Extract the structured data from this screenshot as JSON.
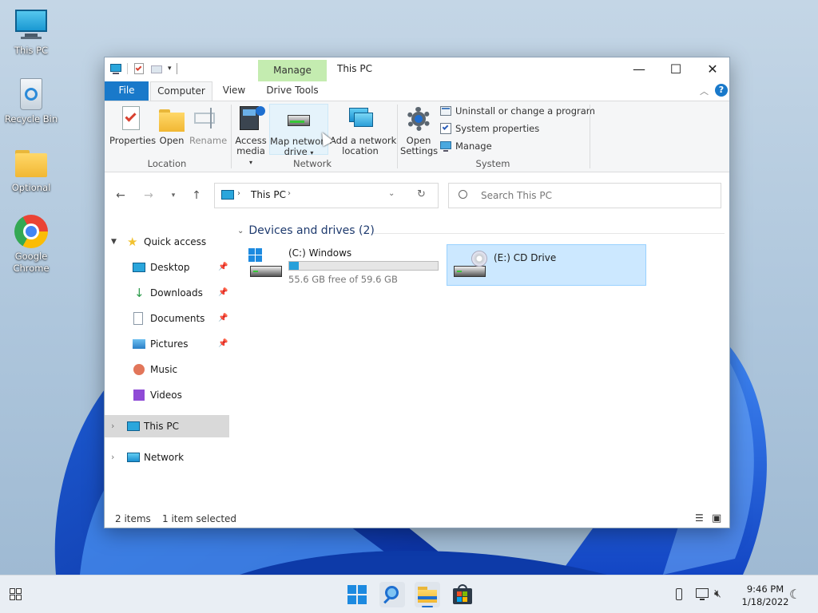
{
  "desktop": {
    "icons": [
      {
        "label": "This PC"
      },
      {
        "label": "Recycle Bin"
      },
      {
        "label": "Optional"
      },
      {
        "label": "Google Chrome"
      }
    ]
  },
  "window": {
    "title": "This PC",
    "context_tab_header": "Manage",
    "accent_color": "#1979ca",
    "tabs": [
      {
        "label": "File"
      },
      {
        "label": "Computer"
      },
      {
        "label": "View"
      },
      {
        "label": "Drive Tools"
      }
    ],
    "ribbon": {
      "location": {
        "label": "Location",
        "buttons": [
          {
            "label": "Properties",
            "icon": "properties-icon"
          },
          {
            "label": "Open",
            "icon": "folder-icon"
          },
          {
            "label": "Rename",
            "icon": "rename-icon"
          }
        ]
      },
      "network": {
        "label": "Network",
        "buttons": [
          {
            "label_line1": "Access",
            "label_line2": "media",
            "icon": "access-media-icon"
          },
          {
            "label_line1": "Map network",
            "label_line2": "drive",
            "icon": "map-drive-icon"
          },
          {
            "label_line1": "Add a network",
            "label_line2": "location",
            "icon": "network-location-icon"
          }
        ]
      },
      "system": {
        "label": "System",
        "open_settings": {
          "label_line1": "Open",
          "label_line2": "Settings"
        },
        "small_buttons": [
          {
            "label": "Uninstall or change a program"
          },
          {
            "label": "System properties"
          },
          {
            "label": "Manage"
          }
        ]
      }
    },
    "address": {
      "path": "This PC",
      "search_placeholder": "Search This PC"
    },
    "nav": {
      "quick_access": "Quick access",
      "items": [
        {
          "label": "Desktop",
          "pinned": true
        },
        {
          "label": "Downloads",
          "pinned": true
        },
        {
          "label": "Documents",
          "pinned": true
        },
        {
          "label": "Pictures",
          "pinned": true
        },
        {
          "label": "Music",
          "pinned": false
        },
        {
          "label": "Videos",
          "pinned": false
        }
      ],
      "this_pc": "This PC",
      "network": "Network"
    },
    "content": {
      "group_title": "Devices and drives (2)",
      "drives": [
        {
          "name": "(C:) Windows",
          "free_text": "55.6 GB free of 59.6 GB",
          "used_fraction": 0.067
        },
        {
          "name": "(E:) CD Drive",
          "selected": true
        }
      ]
    },
    "status": {
      "items": "2 items",
      "selected": "1 item selected"
    }
  },
  "taskbar": {
    "time": "9:46 PM",
    "date": "1/18/2022"
  }
}
